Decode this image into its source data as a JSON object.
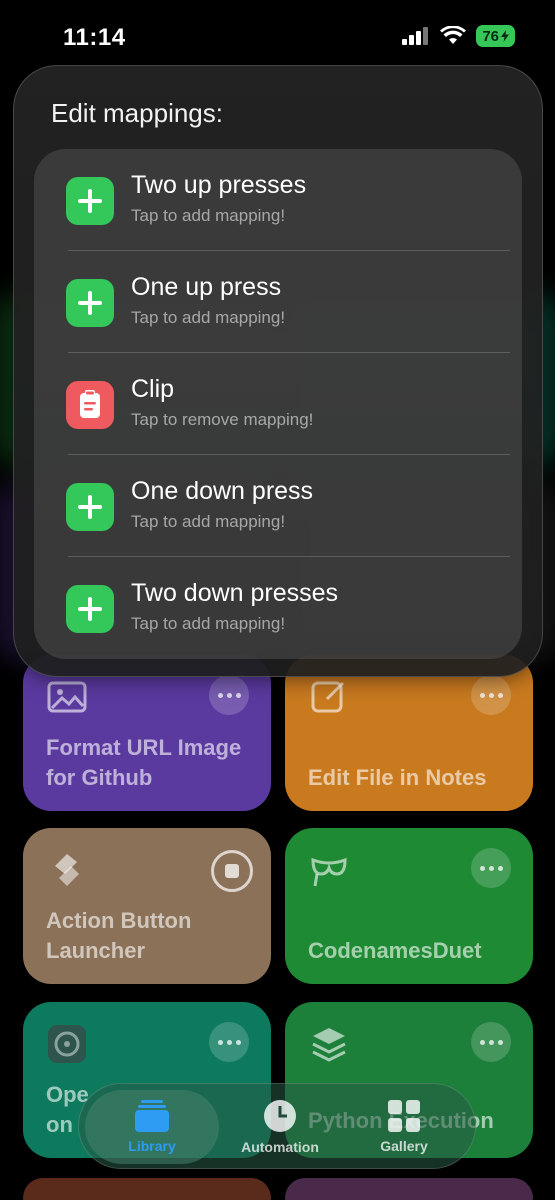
{
  "status_bar": {
    "time": "11:14",
    "battery": "76"
  },
  "overlay": {
    "title": "Edit mappings:",
    "mappings": [
      {
        "label": "Two up presses",
        "subtitle": "Tap to add mapping!",
        "icon": "plus-icon"
      },
      {
        "label": "One up press",
        "subtitle": "Tap to add mapping!",
        "icon": "plus-icon"
      },
      {
        "label": "Clip",
        "subtitle": "Tap to remove mapping!",
        "icon": "clipboard-icon"
      },
      {
        "label": "One down press",
        "subtitle": "Tap to add mapping!",
        "icon": "plus-icon"
      },
      {
        "label": "Two down presses",
        "subtitle": "Tap to add mapping!",
        "icon": "plus-icon"
      }
    ]
  },
  "shortcuts": [
    {
      "title": "Format URL Image for Github",
      "color": "#5b3aa0"
    },
    {
      "title": "Edit File in Notes",
      "color": "#c97a1f"
    },
    {
      "title": "Action Button Launcher",
      "color": "#8a7158"
    },
    {
      "title": "CodenamesDuet",
      "color": "#1e8a34"
    },
    {
      "title": "Ope on",
      "color": "#0d7a5e"
    },
    {
      "title": "Python Execution",
      "color": "#1c7f3a"
    }
  ],
  "tabbar": {
    "tabs": [
      {
        "label": "Library"
      },
      {
        "label": "Automation"
      },
      {
        "label": "Gallery"
      }
    ]
  },
  "colors": {
    "accent": "#2f9cf4",
    "green": "#34c759",
    "red": "#ef5a5f"
  }
}
